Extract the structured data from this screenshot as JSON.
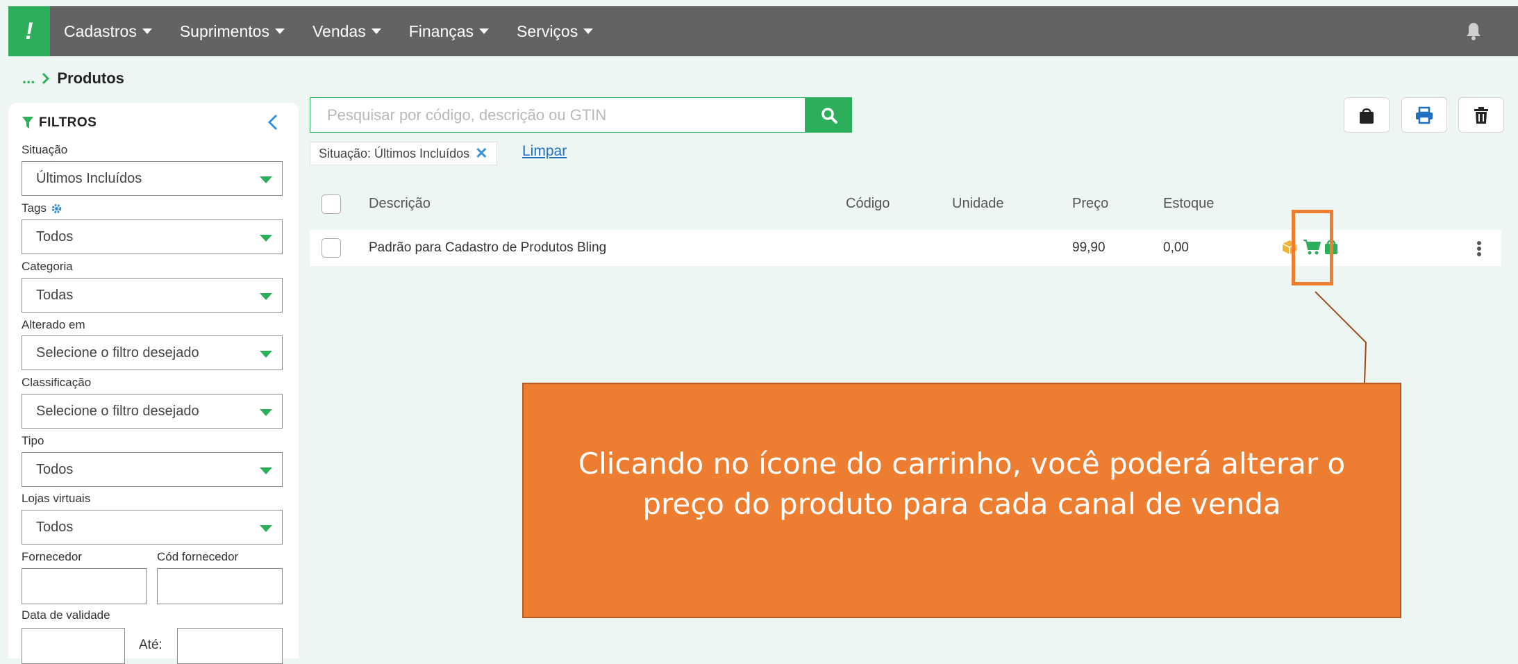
{
  "nav": {
    "logo": "!",
    "items": [
      {
        "label": "Cadastros"
      },
      {
        "label": "Suprimentos"
      },
      {
        "label": "Vendas"
      },
      {
        "label": "Finanças"
      },
      {
        "label": "Serviços"
      }
    ],
    "notification_icon": "bell-icon"
  },
  "breadcrumb": {
    "ellipsis": "...",
    "current": "Produtos"
  },
  "filters": {
    "title": "FILTROS",
    "situacao": {
      "label": "Situação",
      "value": "Últimos Incluídos"
    },
    "tags": {
      "label": "Tags",
      "value": "Todos"
    },
    "categoria": {
      "label": "Categoria",
      "value": "Todas"
    },
    "alterado_em": {
      "label": "Alterado em",
      "value": "Selecione o filtro desejado"
    },
    "classificacao": {
      "label": "Classificação",
      "value": "Selecione o filtro desejado"
    },
    "tipo": {
      "label": "Tipo",
      "value": "Todos"
    },
    "lojas_virtuais": {
      "label": "Lojas virtuais",
      "value": "Todos"
    },
    "fornecedor": {
      "label": "Fornecedor",
      "value": ""
    },
    "cod_fornecedor": {
      "label": "Cód fornecedor",
      "value": ""
    },
    "data_validade": {
      "label": "Data de validade",
      "ate": "Até:"
    }
  },
  "search": {
    "placeholder": "Pesquisar por código, descrição ou GTIN",
    "value": ""
  },
  "active_filter": {
    "label": "Situação: Últimos Incluídos",
    "clear": "Limpar"
  },
  "toolbar": {
    "icons": [
      "shopping-bag-icon",
      "printer-icon",
      "trash-icon"
    ]
  },
  "table": {
    "columns": [
      "Descrição",
      "Código",
      "Unidade",
      "Preço",
      "Estoque"
    ],
    "rows": [
      {
        "descricao": "Padrão para Cadastro de Produtos Bling",
        "codigo": "",
        "unidade": "",
        "preco": "99,90",
        "estoque": "0,00"
      }
    ]
  },
  "callout": {
    "text": "Clicando no ícone do carrinho, você poderá alterar o preço do produto para cada canal de venda"
  },
  "colors": {
    "accent": "#2cae5b",
    "topbar": "#636363",
    "callout": "#ed7d31",
    "link": "#1f6fc1"
  }
}
